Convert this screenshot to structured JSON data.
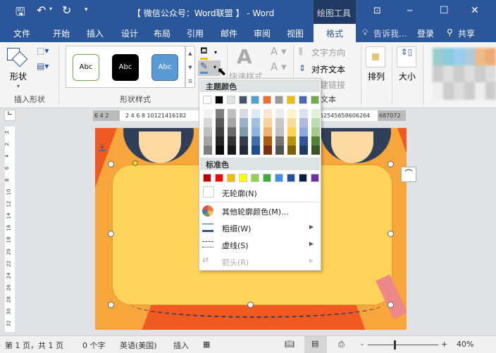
{
  "title": {
    "text": "【 微信公众号：Word联盟 】 - Word",
    "context_tab": "绘图工具",
    "ribbon_display_icon": "ribbon-display-icon"
  },
  "quick_access": {
    "save": "save-icon",
    "undo": "undo-icon",
    "redo": "redo-icon",
    "customize": "customize-icon"
  },
  "window": {
    "minimize": "─",
    "maximize": "☐",
    "close": "✕"
  },
  "tabs": [
    "文件",
    "开始",
    "插入",
    "设计",
    "布局",
    "引用",
    "邮件",
    "审阅",
    "视图",
    "格式"
  ],
  "active_tab": "格式",
  "tell_me": "告诉我...",
  "login": "登录",
  "share": "共享",
  "ribbon": {
    "insert_shapes": {
      "label": "插入形状",
      "shapes_button": "形状"
    },
    "shape_styles": {
      "label": "形状样式",
      "samples": [
        {
          "text": "Abc",
          "bg": "#ffffff",
          "border": "#70ad47",
          "color": "#000"
        },
        {
          "text": "Abc",
          "bg": "#000000",
          "border": "#000",
          "color": "#fff"
        },
        {
          "text": "Abc",
          "bg": "#5b9bd5",
          "border": "#41719c",
          "color": "#fff"
        }
      ]
    },
    "wordart": {
      "quick_styles": "快速样式"
    },
    "text": {
      "direction": "文字方向",
      "align": "对齐文本",
      "link": "创建链接",
      "label": "文本"
    },
    "arrange": "排列",
    "size": "大小"
  },
  "ruler": {
    "left": "6 4 2",
    "main": "2 4 6 8 10121416182",
    "right": "52545658606264",
    "end": "687072"
  },
  "vruler": [
    "2",
    "2",
    "4",
    "6",
    "8",
    "10",
    "12",
    "14",
    "16",
    "18",
    "20",
    "22",
    "24",
    "26",
    "28",
    "30",
    "32"
  ],
  "outline_menu": {
    "theme_header": "主题颜色",
    "theme_colors": [
      "#ffffff",
      "#000000",
      "#dde3e3",
      "#44546a",
      "#4f9fd1",
      "#ed6e2e",
      "#9a9a9a",
      "#f0c000",
      "#4a6aad",
      "#70ad47"
    ],
    "theme_shades": [
      [
        "#f2f2f2",
        "#d8d8d8",
        "#bfbfbf",
        "#a5a5a5",
        "#7f7f7f"
      ],
      [
        "#7f7f7f",
        "#595959",
        "#3f3f3f",
        "#262626",
        "#0c0c0c"
      ],
      [
        "#c0c0c0",
        "#a6a6a6",
        "#6a6a6a",
        "#333333",
        "#191919"
      ],
      [
        "#d6dce4",
        "#9cb1c6",
        "#7e9aab",
        "#333f4f",
        "#222a35"
      ],
      [
        "#deebf6",
        "#9ec1e4",
        "#8db4e2",
        "#3f6faa",
        "#1f4e8c"
      ],
      [
        "#fbe5d5",
        "#f8d49a",
        "#f0b070",
        "#b0590e",
        "#7e2f12"
      ],
      [
        "#ededed",
        "#c8c8c8",
        "#c0c0c0",
        "#7b7070",
        "#525252"
      ],
      [
        "#fff2cc",
        "#f8dc96",
        "#ffd34d",
        "#b8900a",
        "#7f6000"
      ],
      [
        "#d9e2f3",
        "#b0b8df",
        "#8eaadb",
        "#2f54a0",
        "#203864"
      ],
      [
        "#e2efd9",
        "#bcdcb4",
        "#a8c98e",
        "#538135",
        "#375623"
      ]
    ],
    "standard_header": "标准色",
    "standard_colors": [
      "#c00000",
      "#ff0000",
      "#f0c000",
      "#ffff00",
      "#92d050",
      "#3cae3c",
      "#4090ea",
      "#2050a0",
      "#0c1c40",
      "#7030a0"
    ],
    "no_outline": "无轮廓(N)",
    "more_colors": "其他轮廓颜色(M)...",
    "weight": "粗细(W)",
    "dashes": "虚线(S)",
    "arrows": "箭头(R)"
  },
  "status": {
    "page": "第 1 页，共 1 页",
    "words": "0 个字",
    "language": "英语(美国)",
    "mode": "插入",
    "zoom_minus": "-",
    "zoom_plus": "+",
    "zoom": "40%",
    "zoom_level": 40
  }
}
